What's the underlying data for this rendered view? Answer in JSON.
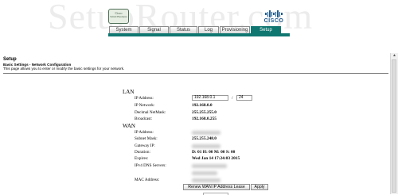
{
  "watermark": "SetupRouter.com",
  "header": {
    "logo_line1": "Cisco",
    "logo_line2": "Small Business",
    "brand_word": "CISCO"
  },
  "tabs": [
    {
      "label": "System"
    },
    {
      "label": "Signal"
    },
    {
      "label": "Status"
    },
    {
      "label": "Log"
    },
    {
      "label": "Provisioning"
    },
    {
      "label": "Setup"
    }
  ],
  "page": {
    "title": "Setup",
    "subtitle": "Basic Settings - Network Configuration",
    "description": "This page allows you to enter or modify the basic settings for your network."
  },
  "lan": {
    "heading": "LAN",
    "ip_label": "IP Address:",
    "ip_value": "192.168.0.1",
    "prefix_value": "24",
    "prefix_sep": "/",
    "network_label": "IP Network:",
    "network_value": "192.168.0.0",
    "netmask_label": "Decimal NetMask:",
    "netmask_value": "255.255.255.0",
    "broadcast_label": "Broadcast:",
    "broadcast_value": "192.168.0.255"
  },
  "wan": {
    "heading": "WAN",
    "ip_label": "IP Address:",
    "subnet_label": "Subnet Mask:",
    "subnet_value": "255.255.248.0",
    "gateway_label": "Gateway IP:",
    "duration_label": "Duration:",
    "duration_value": "D: 01 H: 00 M: 00 S: 00",
    "expires_label": "Expires:",
    "expires_value": "Wed Jan 14 17:24:03 2015",
    "dns_label": "IPv4 DNS Servers:",
    "mac_label": "MAC Address:",
    "renew_button": "Renew WAN IP Address Lease",
    "apply_button": "Apply"
  }
}
